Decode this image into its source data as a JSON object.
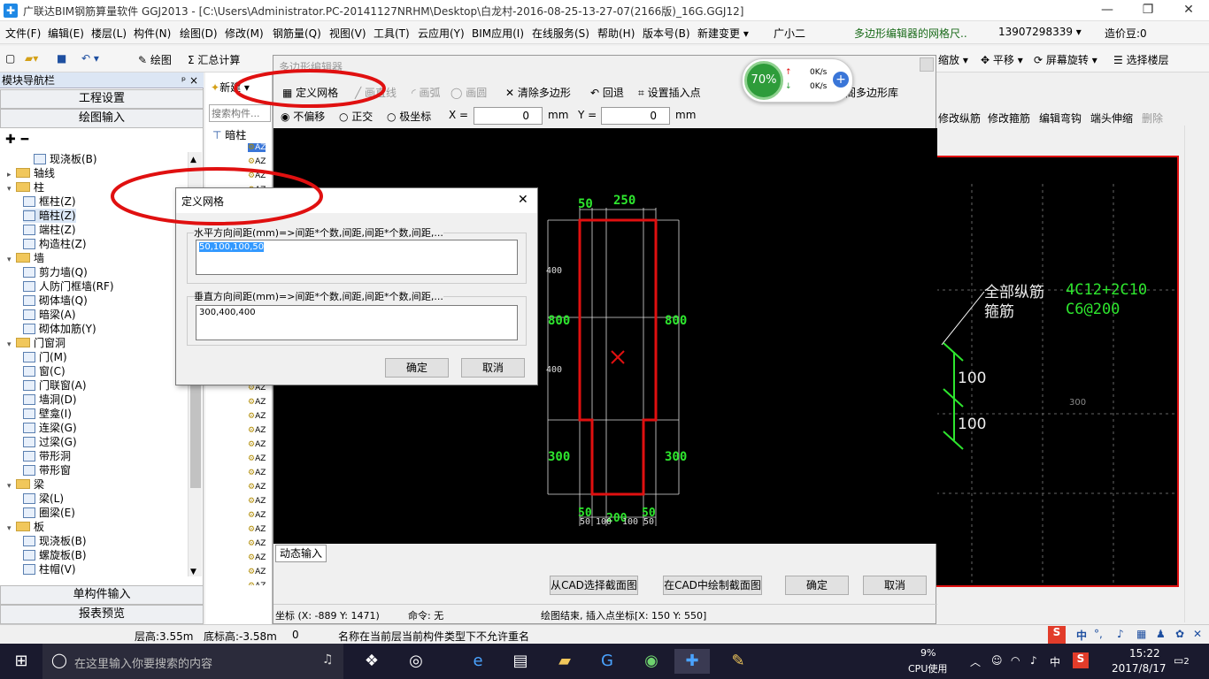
{
  "window": {
    "title": "广联达BIM钢筋算量软件 GGJ2013 - [C:\\Users\\Administrator.PC-20141127NRHM\\Desktop\\白龙村-2016-08-25-13-27-07(2166版)_16G.GGJ12]",
    "min": "—",
    "max": "❐",
    "close": "✕"
  },
  "menu": [
    "文件(F)",
    "编辑(E)",
    "楼层(L)",
    "构件(N)",
    "绘图(D)",
    "修改(M)",
    "钢筋量(Q)",
    "视图(V)",
    "工具(T)",
    "云应用(Y)",
    "BIM应用(I)",
    "在线服务(S)",
    "帮助(H)",
    "版本号(B)",
    "新建变更 ▾",
    "广小二",
    "多边形编辑器的网格尺..",
    "13907298339 ▾",
    "造价豆:0"
  ],
  "toolbar": {
    "draw": "绘图",
    "sum": "汇总计算",
    "zoom": "缩放 ▾",
    "pan": "平移 ▾",
    "rotate": "屏幕旋转 ▾",
    "select_floor": "选择楼层"
  },
  "nav": {
    "header": "模块导航栏",
    "pin": "ᵖ ×",
    "tab_project": "工程设置",
    "tab_draw": "绘图输入",
    "tree": [
      {
        "label": "现浇板(B)",
        "lvl": 2,
        "type": "item"
      },
      {
        "label": "轴线",
        "lvl": 0,
        "type": "folder",
        "exp": "▸"
      },
      {
        "label": "柱",
        "lvl": 0,
        "type": "folder",
        "exp": "▾"
      },
      {
        "label": "框柱(Z)",
        "lvl": 1,
        "type": "item"
      },
      {
        "label": "暗柱(Z)",
        "lvl": 1,
        "type": "item"
      },
      {
        "label": "端柱(Z)",
        "lvl": 1,
        "type": "item"
      },
      {
        "label": "构造柱(Z)",
        "lvl": 1,
        "type": "item"
      },
      {
        "label": "墙",
        "lvl": 0,
        "type": "folder",
        "exp": "▾"
      },
      {
        "label": "剪力墙(Q)",
        "lvl": 1,
        "type": "item"
      },
      {
        "label": "人防门框墙(RF)",
        "lvl": 1,
        "type": "item"
      },
      {
        "label": "砌体墙(Q)",
        "lvl": 1,
        "type": "item"
      },
      {
        "label": "暗梁(A)",
        "lvl": 1,
        "type": "item"
      },
      {
        "label": "砌体加筋(Y)",
        "lvl": 1,
        "type": "item"
      },
      {
        "label": "门窗洞",
        "lvl": 0,
        "type": "folder",
        "exp": "▾"
      },
      {
        "label": "门(M)",
        "lvl": 1,
        "type": "item"
      },
      {
        "label": "窗(C)",
        "lvl": 1,
        "type": "item"
      },
      {
        "label": "门联窗(A)",
        "lvl": 1,
        "type": "item"
      },
      {
        "label": "墙洞(D)",
        "lvl": 1,
        "type": "item"
      },
      {
        "label": "壁龛(I)",
        "lvl": 1,
        "type": "item"
      },
      {
        "label": "连梁(G)",
        "lvl": 1,
        "type": "item"
      },
      {
        "label": "过梁(G)",
        "lvl": 1,
        "type": "item"
      },
      {
        "label": "带形洞",
        "lvl": 1,
        "type": "item"
      },
      {
        "label": "带形窗",
        "lvl": 1,
        "type": "item"
      },
      {
        "label": "梁",
        "lvl": 0,
        "type": "folder",
        "exp": "▾"
      },
      {
        "label": "梁(L)",
        "lvl": 1,
        "type": "item"
      },
      {
        "label": "圈梁(E)",
        "lvl": 1,
        "type": "item"
      },
      {
        "label": "板",
        "lvl": 0,
        "type": "folder",
        "exp": "▾"
      },
      {
        "label": "现浇板(B)",
        "lvl": 1,
        "type": "item"
      },
      {
        "label": "螺旋板(B)",
        "lvl": 1,
        "type": "item"
      },
      {
        "label": "柱帽(V)",
        "lvl": 1,
        "type": "item"
      }
    ],
    "tab_single": "单构件输入",
    "tab_report": "报表预览"
  },
  "mid": {
    "new": "新建 ▾",
    "search_placeholder": "搜索构件...",
    "root": "暗柱",
    "item": "AZ"
  },
  "editor": {
    "title": "多边形编辑器",
    "tools": [
      "定义网格",
      "画直线",
      "画弧",
      "画圆",
      "清除多边形",
      "回退",
      "设置插入点"
    ],
    "lib": "阁多边形库",
    "modes": [
      "不偏移",
      "正交",
      "极坐标"
    ],
    "x_label": "X =",
    "x_val": "0",
    "y_label": "Y =",
    "y_val": "0",
    "unit": "mm",
    "dyn": "动态输入",
    "btn_cad_select": "从CAD选择截面图",
    "btn_cad_draw": "在CAD中绘制截面图",
    "ok": "确定",
    "cancel": "取消",
    "coord": "坐标 (X: -889 Y: 1471)",
    "cmd": "命令: 无",
    "status": "绘图结束, 插入点坐标[X: 150 Y: 550]"
  },
  "dims": {
    "top_a": "50",
    "top_b": "250",
    "left_mid": "800",
    "right_mid": "800",
    "left_bot": "300",
    "right_bot": "300",
    "small_400a": "400",
    "small_400b": "400",
    "bot_a": "50",
    "bot_b": "200",
    "bot_c": "50",
    "bot_d": "50",
    "bot_e": "100",
    "bot_f": "100",
    "bot_g": "50"
  },
  "dialog": {
    "title": "定义网格",
    "close": "✕",
    "h_label": "水平方向间距(mm)=>间距*个数,间距,间距*个数,间距,...",
    "h_value": "50,100,100,50",
    "v_label": "垂直方向间距(mm)=>间距*个数,间距,间距*个数,间距,...",
    "v_value": "300,400,400",
    "ok": "确定",
    "cancel": "取消"
  },
  "right": {
    "tools": [
      "修改纵筋",
      "修改箍筋",
      "编辑弯钩",
      "端头伸缩",
      "删除"
    ],
    "label1": "全部纵筋",
    "label2": "箍筋",
    "val1": "4C12+2C10",
    "val2": "C6@200",
    "d1": "100",
    "d2": "100",
    "grid": "300"
  },
  "netwidget": {
    "pct": "70%",
    "up": "0K/s",
    "down": "0K/s"
  },
  "statusbar": {
    "floor_h": "层高:3.55m",
    "bottom_h": "底标高:-3.58m",
    "zero": "0",
    "msg": "名称在当前层当前构件类型下不允许重名"
  },
  "ime": {
    "lang": "中",
    "cpu": "9%",
    "cpu_lbl": "CPU使用",
    "tray_lang": "中",
    "time": "15:22",
    "date": "2017/8/17",
    "notif": "2"
  },
  "taskbar": {
    "search_placeholder": "在这里输入你要搜索的内容"
  }
}
